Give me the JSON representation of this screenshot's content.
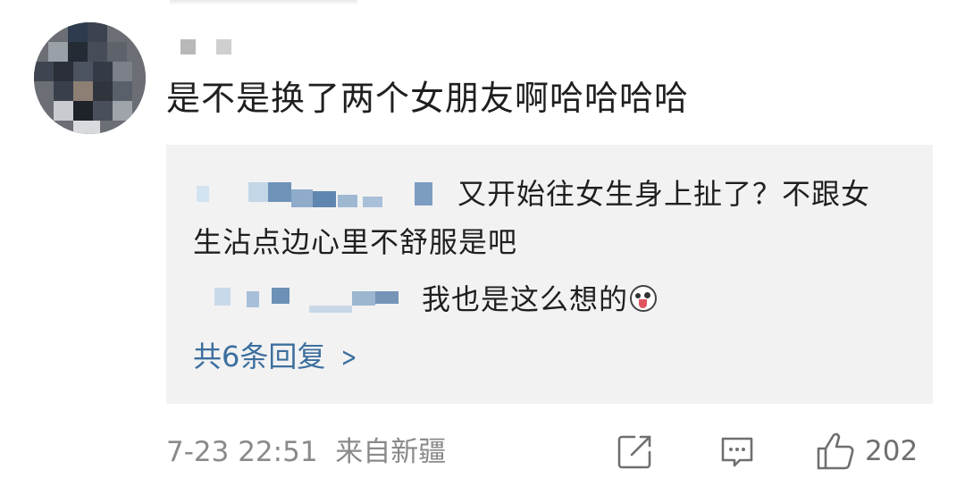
{
  "comment": {
    "text": "是不是换了两个女朋友啊哈哈哈哈",
    "timestamp": "7-23 22:51",
    "location": "来自新疆",
    "like_count": "202"
  },
  "replies": [
    {
      "text": "又开始往女生身上扯了？不跟女生沾点边心里不舒服是吧"
    },
    {
      "text": "我也是这么想的"
    }
  ],
  "more_replies_label": "共6条回复",
  "icons": {
    "share": "share-icon",
    "comment": "comment-icon",
    "like": "thumbs-up-icon",
    "emoji": "tongue-out-emoji-icon",
    "chevron": "chevron-right-icon"
  },
  "colors": {
    "text": "#1f1f1f",
    "meta": "#8a8a8a",
    "link": "#3d6f9e",
    "reply_bg": "#f2f2f3"
  }
}
